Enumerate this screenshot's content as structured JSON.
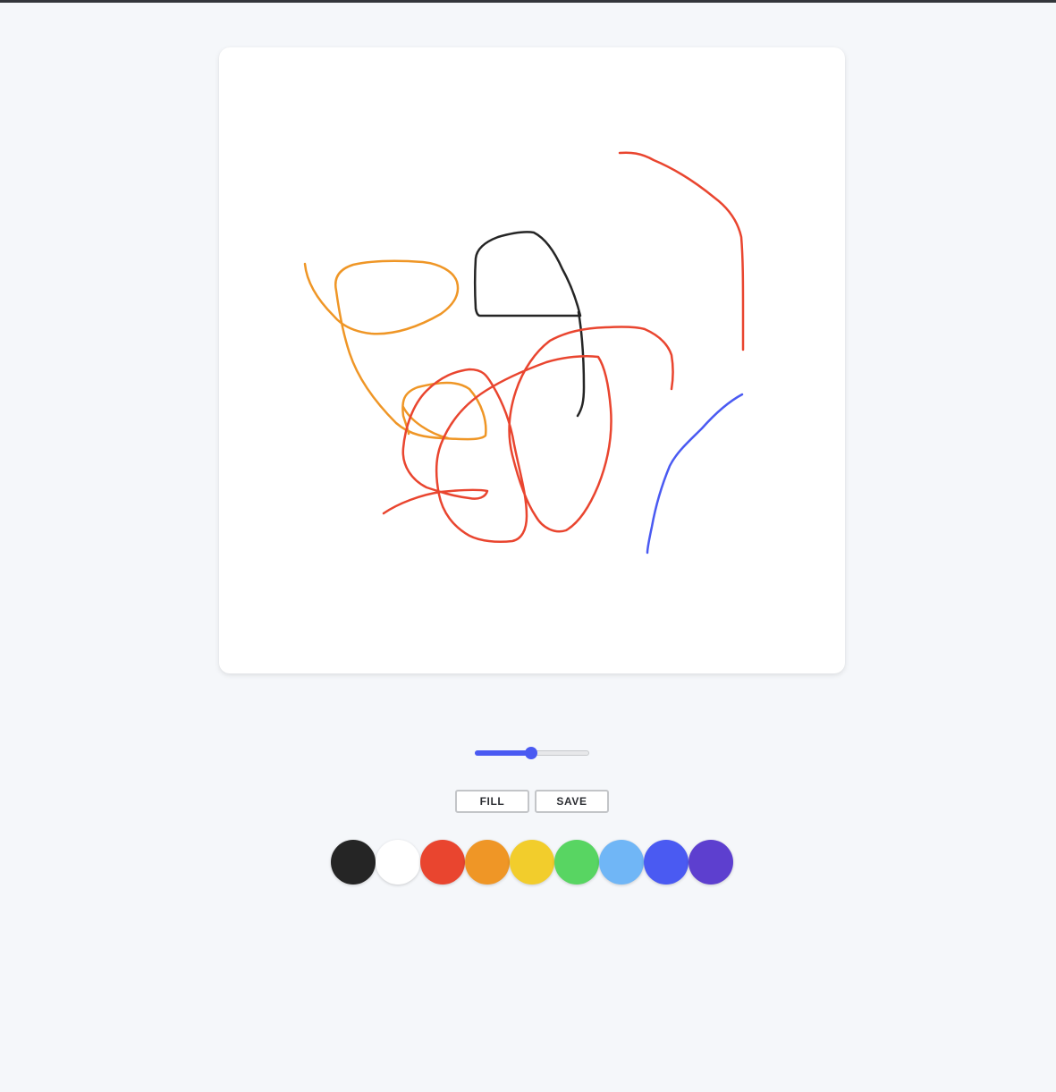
{
  "toolbar": {
    "fill_label": "FILL",
    "save_label": "SAVE"
  },
  "brush_size_slider": {
    "value_fraction": 0.49
  },
  "palette": {
    "colors": [
      {
        "name": "black",
        "hex": "#252525"
      },
      {
        "name": "white",
        "hex": "#ffffff"
      },
      {
        "name": "red",
        "hex": "#e9452f"
      },
      {
        "name": "orange",
        "hex": "#ef9626"
      },
      {
        "name": "yellow",
        "hex": "#f2cd2c"
      },
      {
        "name": "green",
        "hex": "#58d562"
      },
      {
        "name": "light-blue",
        "hex": "#70b6f6"
      },
      {
        "name": "blue",
        "hex": "#4a5af2"
      },
      {
        "name": "purple",
        "hex": "#5d3fcf"
      }
    ]
  },
  "strokes": [
    {
      "color": "#ef9626"
    },
    {
      "color": "#ef9626"
    },
    {
      "color": "#252525"
    },
    {
      "color": "#e9452f"
    },
    {
      "color": "#e9452f"
    },
    {
      "color": "#4a5af2"
    },
    {
      "color": "#5d3fcf"
    }
  ]
}
